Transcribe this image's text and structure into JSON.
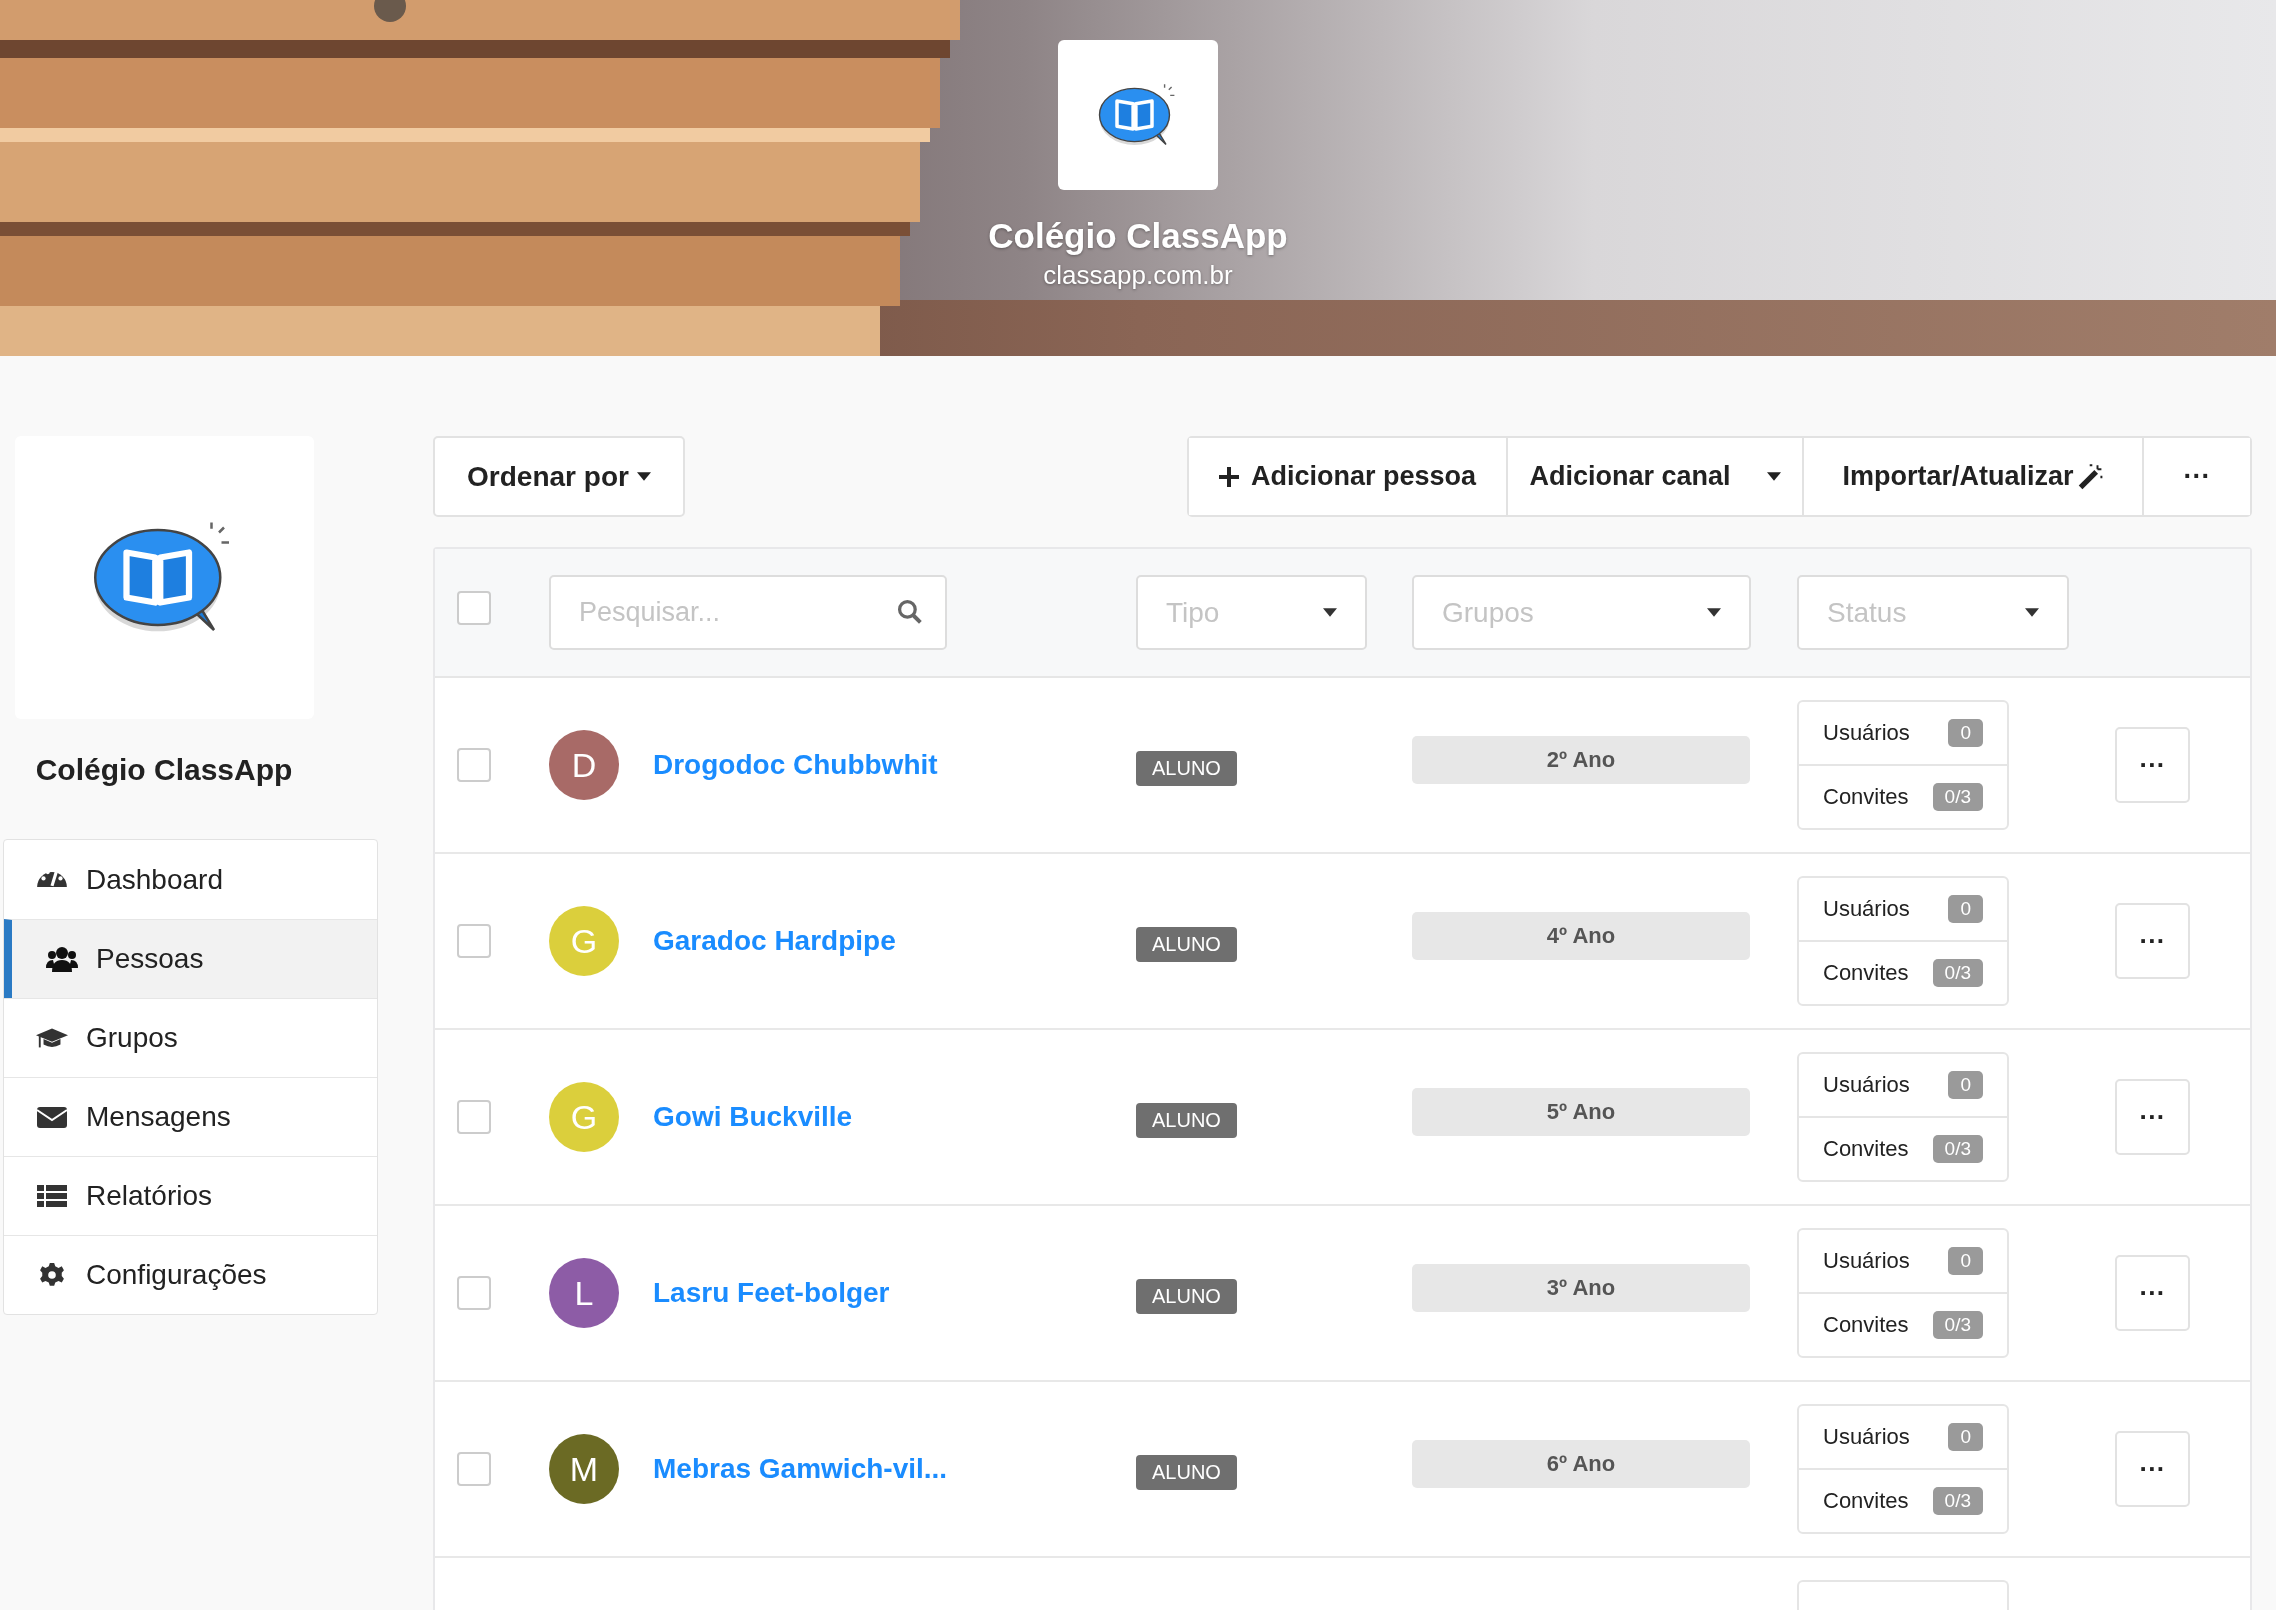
{
  "header": {
    "title": "Colégio ClassApp",
    "subtitle": "classapp.com.br"
  },
  "sidebar": {
    "school_name": "Colégio ClassApp",
    "items": [
      {
        "label": "Dashboard",
        "selected": false
      },
      {
        "label": "Pessoas",
        "selected": true
      },
      {
        "label": "Grupos",
        "selected": false
      },
      {
        "label": "Mensagens",
        "selected": false
      },
      {
        "label": "Relatórios",
        "selected": false
      },
      {
        "label": "Configurações",
        "selected": false
      }
    ]
  },
  "toolbar": {
    "sort_button": "Ordenar por",
    "add_person": "Adicionar pessoa",
    "add_channel": "Adicionar canal",
    "import_update": "Importar/Atualizar",
    "more": "···"
  },
  "filters": {
    "select_all_checked": false,
    "search": {
      "placeholder": "Pesquisar..."
    },
    "type": {
      "placeholder": "Tipo"
    },
    "groups": {
      "placeholder": "Grupos"
    },
    "status": {
      "placeholder": "Status"
    }
  },
  "people": [
    {
      "checked": false,
      "initial": "D",
      "color": "#a86a67",
      "name": "Drogodoc Chubbwhit",
      "type": "ALUNO",
      "group": "2º Ano",
      "users_label": "Usuários",
      "users": "0",
      "invites_label": "Convites",
      "invites": "0/3",
      "more": "···"
    },
    {
      "checked": false,
      "initial": "G",
      "color": "#dbcf3c",
      "name": "Garadoc Hardpipe",
      "type": "ALUNO",
      "group": "4º Ano",
      "users_label": "Usuários",
      "users": "0",
      "invites_label": "Convites",
      "invites": "0/3",
      "more": "···"
    },
    {
      "checked": false,
      "initial": "G",
      "color": "#dbcf3c",
      "name": "Gowi Buckville",
      "type": "ALUNO",
      "group": "5º Ano",
      "users_label": "Usuários",
      "users": "0",
      "invites_label": "Convites",
      "invites": "0/3",
      "more": "···"
    },
    {
      "checked": false,
      "initial": "L",
      "color": "#8d5ca6",
      "name": "Lasru Feet-bolger",
      "type": "ALUNO",
      "group": "3º Ano",
      "users_label": "Usuários",
      "users": "0",
      "invites_label": "Convites",
      "invites": "0/3",
      "more": "···"
    },
    {
      "checked": false,
      "initial": "M",
      "color": "#6b6a24",
      "name": "Mebras Gamwich-vil...",
      "type": "ALUNO",
      "group": "6º Ano",
      "users_label": "Usuários",
      "users": "0",
      "invites_label": "Convites",
      "invites": "0/3",
      "more": "···"
    }
  ]
}
